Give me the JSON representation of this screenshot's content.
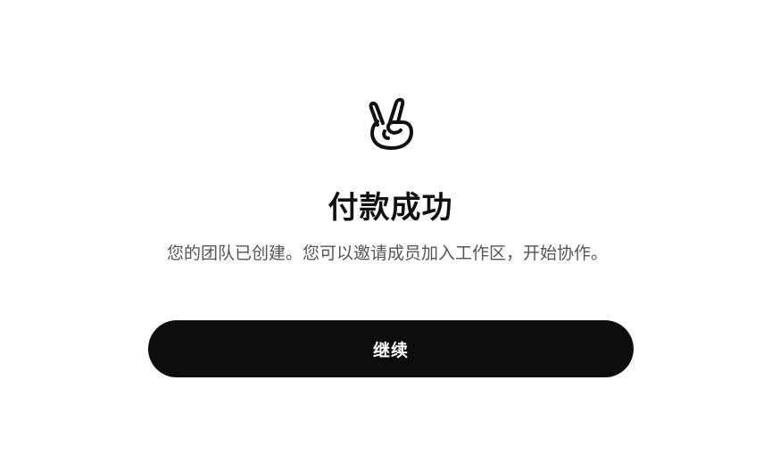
{
  "success": {
    "icon": "victory-hand-icon",
    "title": "付款成功",
    "subtitle": "您的团队已创建。您可以邀请成员加入工作区，开始协作。",
    "continue_label": "继续"
  },
  "colors": {
    "button_bg": "#0d0d0d",
    "button_text": "#ffffff",
    "title_text": "#111111",
    "subtitle_text": "#555555"
  }
}
